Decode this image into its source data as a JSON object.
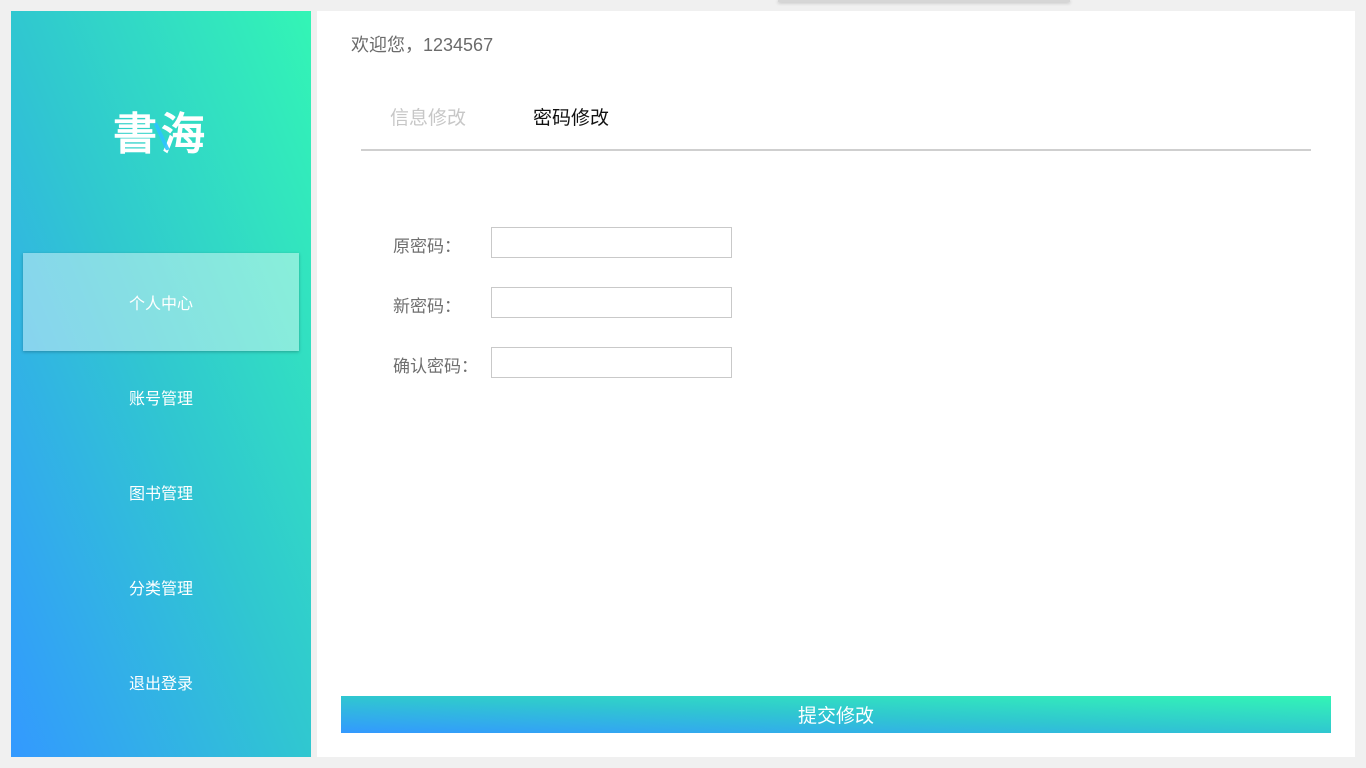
{
  "logo": {
    "char1": "書",
    "char2": "海"
  },
  "sidebar": {
    "items": [
      {
        "label": "个人中心",
        "active": true
      },
      {
        "label": "账号管理"
      },
      {
        "label": "图书管理"
      },
      {
        "label": "分类管理"
      },
      {
        "label": "退出登录"
      }
    ]
  },
  "header": {
    "welcome": "欢迎您，1234567"
  },
  "tabs": [
    {
      "label": "信息修改",
      "active": false
    },
    {
      "label": "密码修改",
      "active": true
    }
  ],
  "form": {
    "old_password": {
      "label": "原密码：",
      "value": ""
    },
    "new_password": {
      "label": "新密码：",
      "value": ""
    },
    "confirm_password": {
      "label": "确认密码：",
      "value": ""
    },
    "submit_label": "提交修改"
  },
  "colors": {
    "gradient_blue": "#3399ff",
    "gradient_teal": "#30c7d0",
    "gradient_green": "#33f5b5"
  }
}
